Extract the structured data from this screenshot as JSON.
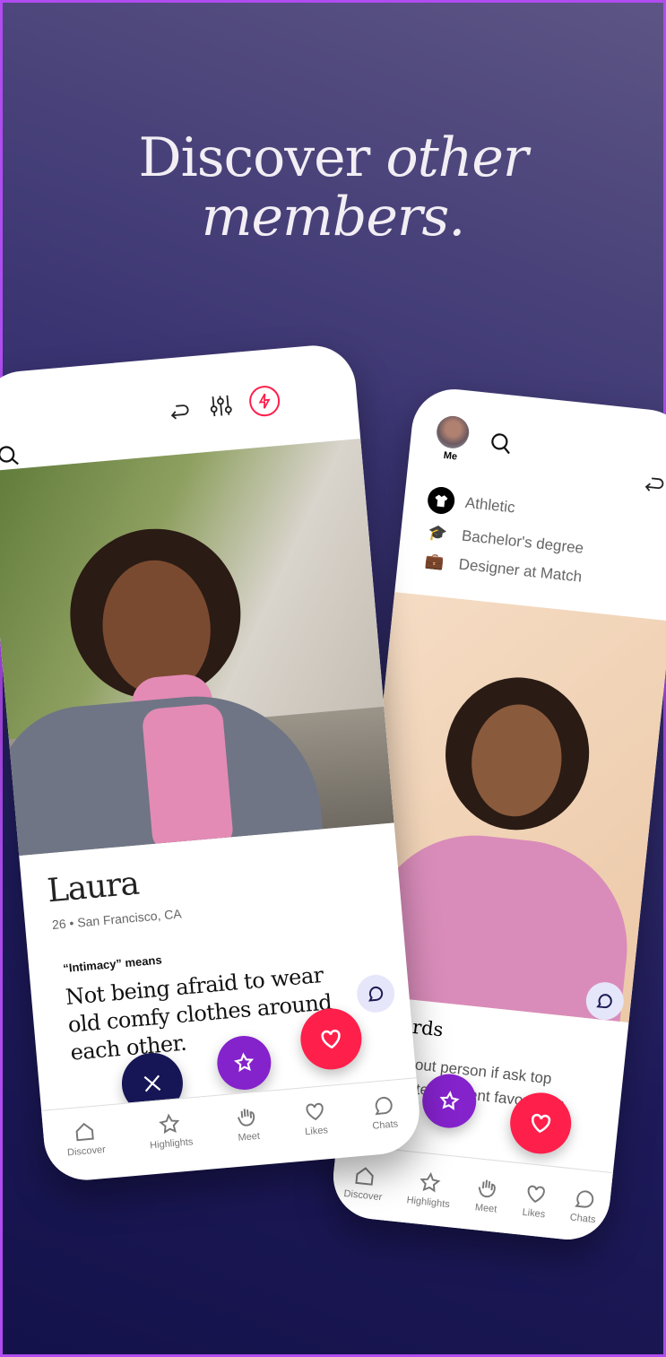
{
  "headline": {
    "line1": "Discover ",
    "line1_italic": "other",
    "line2_italic": "members."
  },
  "left_phone": {
    "profile": {
      "name": "Laura",
      "details": "26 • San Francisco, CA",
      "prompt_label": "“Intimacy” means",
      "prompt_answer": "Not being afraid to wear old comfy clothes around each other."
    },
    "tabs": [
      {
        "label": "Discover",
        "icon": "home-icon"
      },
      {
        "label": "Highlights",
        "icon": "star-icon"
      },
      {
        "label": "Meet",
        "icon": "wave-icon"
      },
      {
        "label": "Likes",
        "icon": "heart-icon"
      },
      {
        "label": "Chats",
        "icon": "chat-icon"
      }
    ]
  },
  "right_phone": {
    "me_label": "Me",
    "attributes": [
      {
        "icon": "shirt-icon",
        "label": "Athletic"
      },
      {
        "icon": "graduation-cap-icon",
        "label": "Bachelor's degree"
      },
      {
        "icon": "briefcase-icon",
        "label": "Designer at Match"
      }
    ],
    "prompt_title": "words",
    "prompt_text": "ot about person if ask top favorite ly recent favorite as",
    "tabs": [
      {
        "label": "Discover",
        "icon": "home-icon"
      },
      {
        "label": "Highlights",
        "icon": "star-icon"
      },
      {
        "label": "Meet",
        "icon": "wave-icon"
      },
      {
        "label": "Likes",
        "icon": "heart-icon"
      },
      {
        "label": "Chats",
        "icon": "chat-icon"
      }
    ]
  },
  "colors": {
    "pass": "#161656",
    "superlike": "#8422cc",
    "like": "#ff1f4b",
    "boost": "#ff1f4b"
  }
}
